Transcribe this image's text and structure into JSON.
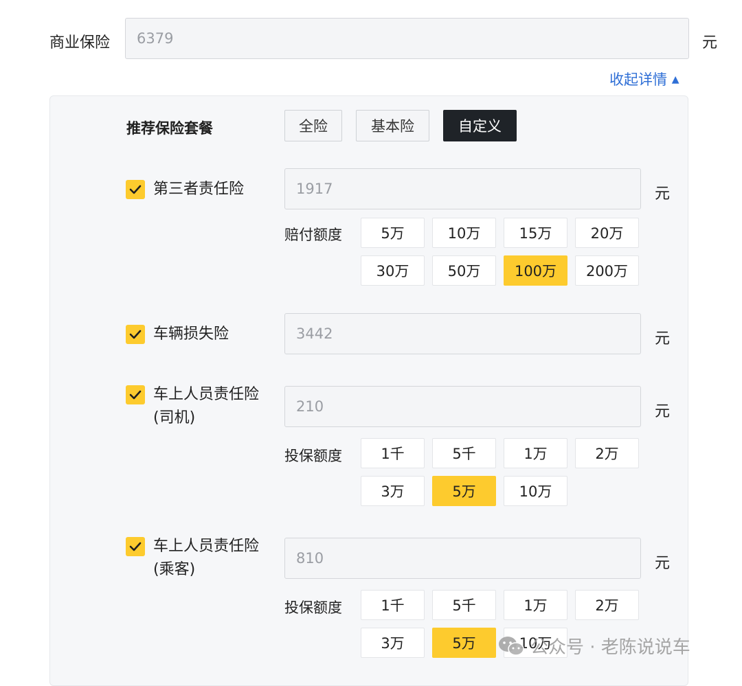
{
  "commercial": {
    "label": "商业保险",
    "value": "6379",
    "unit": "元"
  },
  "collapse_link": {
    "label": "收起详情",
    "arrow": "▲"
  },
  "packages": {
    "title": "推荐保险套餐",
    "options": [
      "全险",
      "基本险",
      "自定义"
    ],
    "selected": "自定义"
  },
  "third_party": {
    "name": "第三者责任险",
    "value": "1917",
    "unit": "元",
    "checked": true,
    "option_label": "赔付额度",
    "options": [
      "5万",
      "10万",
      "15万",
      "20万",
      "30万",
      "50万",
      "100万",
      "200万"
    ],
    "selected": "100万"
  },
  "vehicle_damage": {
    "name": "车辆损失险",
    "value": "3442",
    "unit": "元",
    "checked": true
  },
  "driver": {
    "name_line1": "车上人员责任险",
    "name_line2": "(司机)",
    "value": "210",
    "unit": "元",
    "checked": true,
    "option_label": "投保额度",
    "options": [
      "1千",
      "5千",
      "1万",
      "2万",
      "3万",
      "5万",
      "10万"
    ],
    "selected": "5万"
  },
  "passenger": {
    "name_line1": "车上人员责任险",
    "name_line2": "(乘客)",
    "value": "810",
    "unit": "元",
    "checked": true,
    "option_label": "投保额度",
    "options": [
      "1千",
      "5千",
      "1万",
      "2万",
      "3万",
      "5万",
      "10万"
    ],
    "selected": "5万"
  },
  "watermark": {
    "text": "公众号 · 老陈说说车",
    "icon": "wechat-icon"
  },
  "colors": {
    "accent_yellow": "#fdcb2e",
    "link_blue": "#2f6fd6",
    "dark_button": "#1f2328"
  }
}
